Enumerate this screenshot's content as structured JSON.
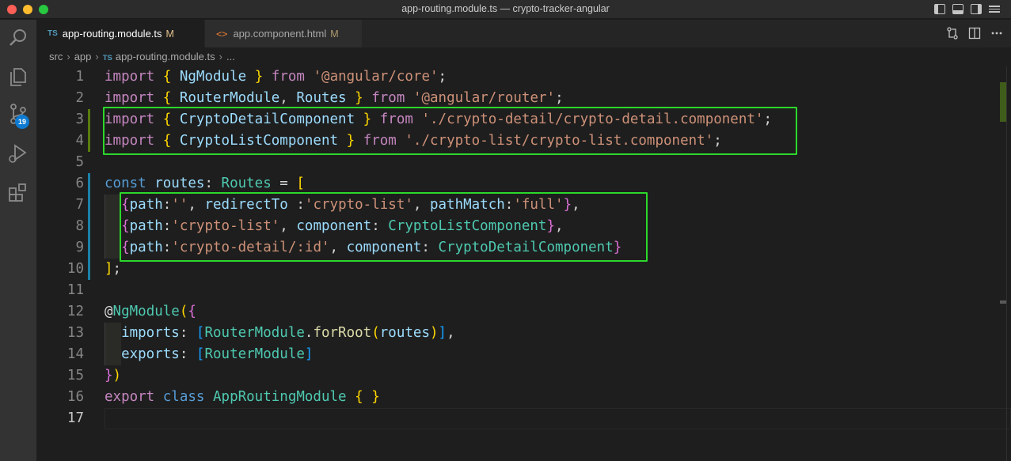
{
  "window": {
    "title": "app-routing.module.ts — crypto-tracker-angular"
  },
  "activity_bar": {
    "icons": [
      "files-icon",
      "search-icon",
      "source-control-icon",
      "run-debug-icon",
      "extensions-icon"
    ],
    "source_control_badge": "19"
  },
  "tabs": [
    {
      "icon": "TS",
      "label": "app-routing.module.ts",
      "modified": "M",
      "active": true
    },
    {
      "icon": "<>",
      "label": "app.component.html",
      "modified": "M",
      "active": false
    }
  ],
  "breadcrumb": {
    "parts": [
      "src",
      "app"
    ],
    "file_icon": "TS",
    "file": "app-routing.module.ts",
    "tail": "..."
  },
  "editor": {
    "line_numbers": [
      "1",
      "2",
      "3",
      "4",
      "5",
      "6",
      "7",
      "8",
      "9",
      "10",
      "11",
      "12",
      "13",
      "14",
      "15",
      "16",
      "17"
    ],
    "highlight_color": "#2bd82b"
  }
}
